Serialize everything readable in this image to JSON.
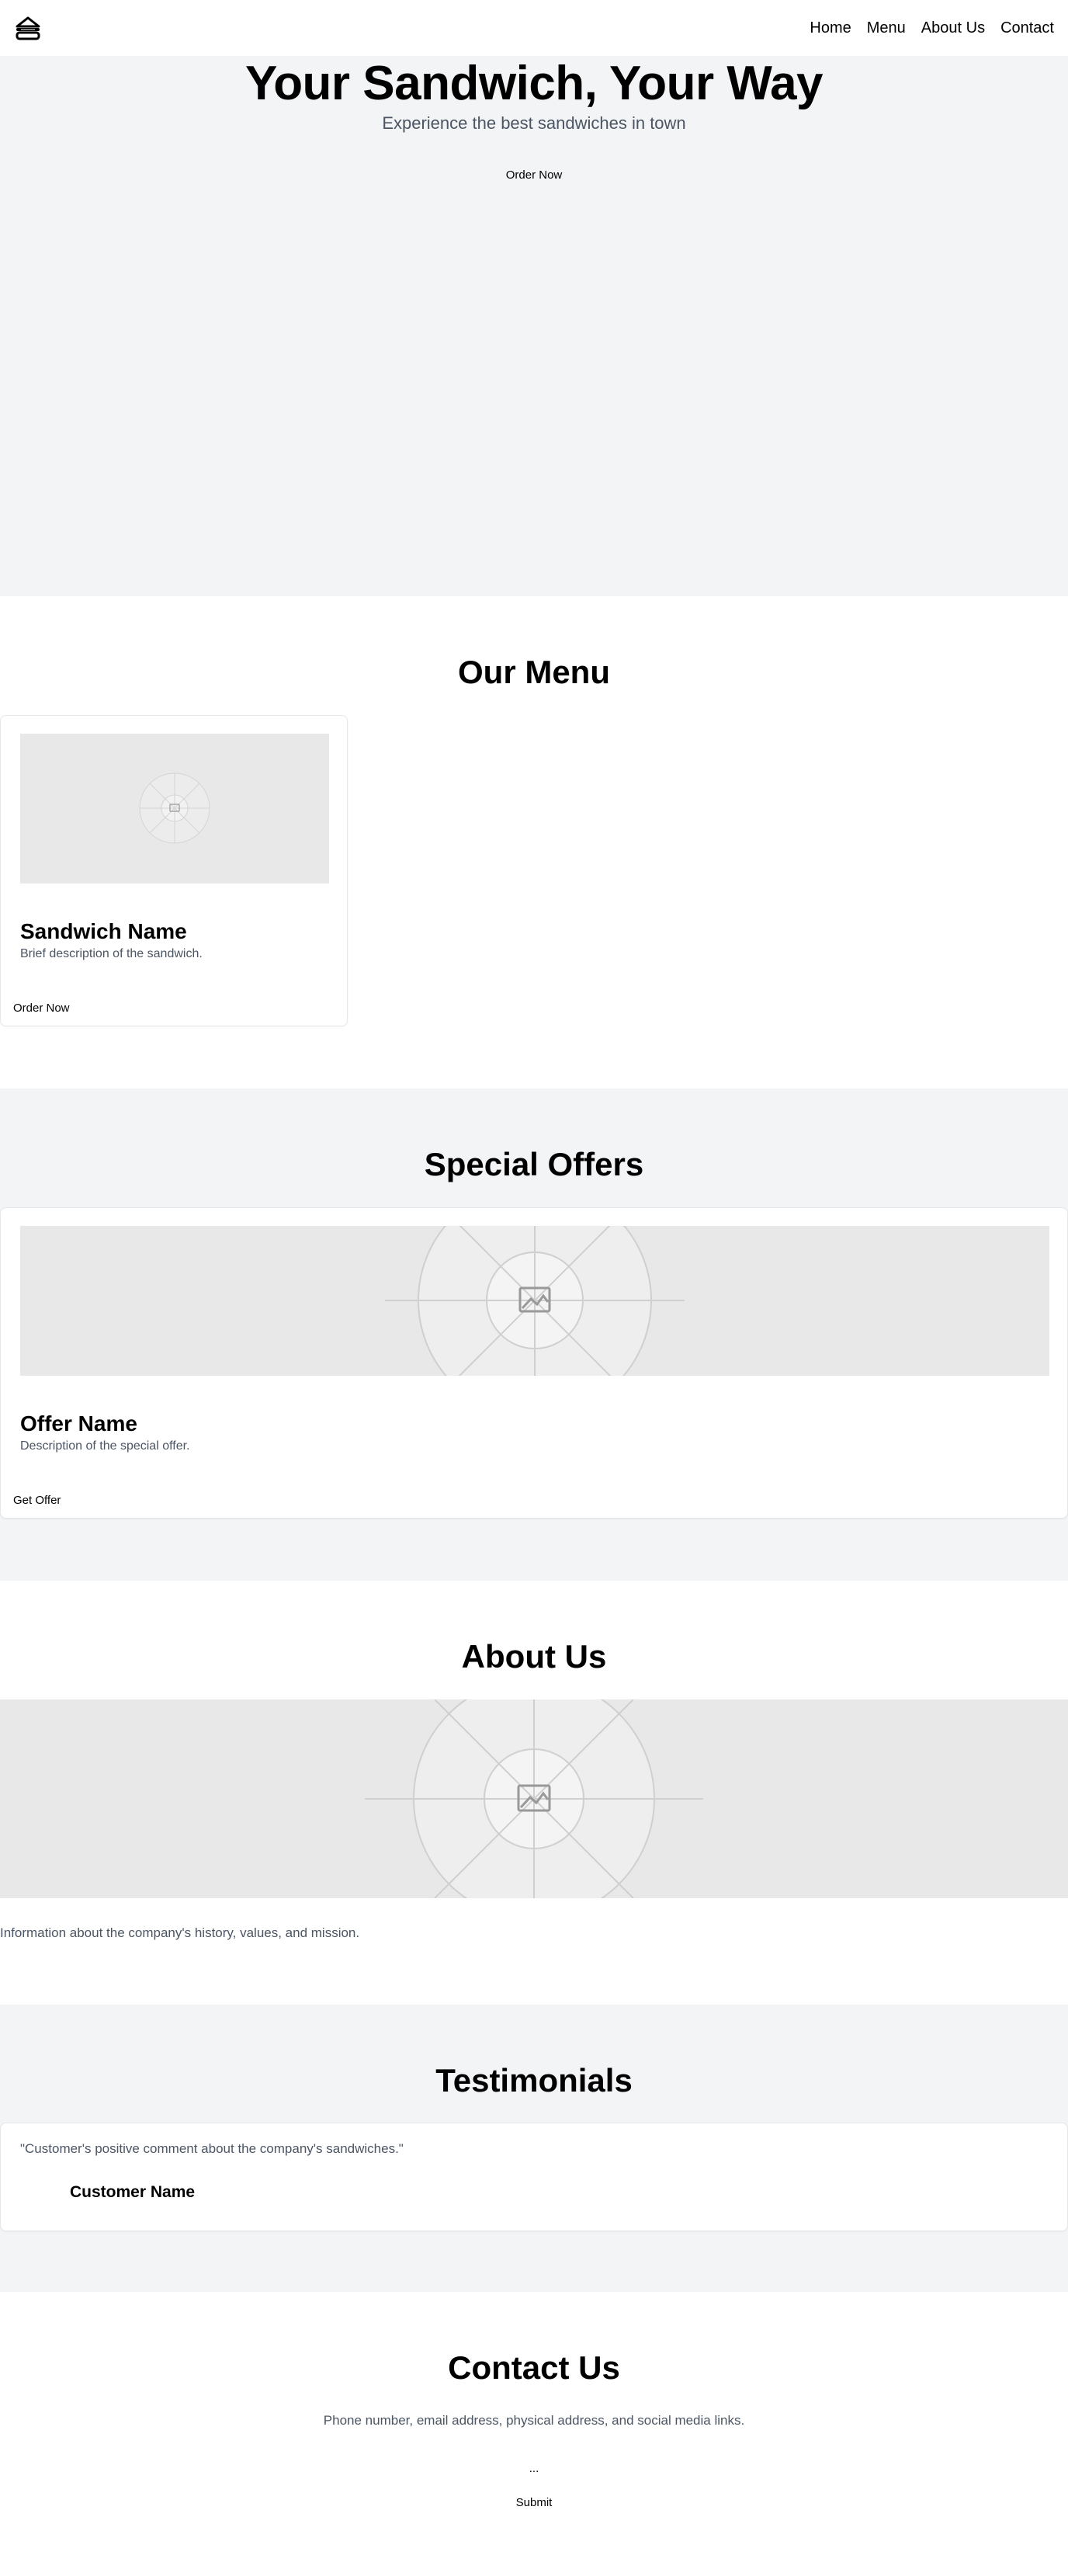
{
  "nav": {
    "logo_icon": "sandwich-icon",
    "links": [
      "Home",
      "Menu",
      "About Us",
      "Contact"
    ]
  },
  "hero": {
    "title": "Your Sandwich, Your Way",
    "subtitle": "Experience the best sandwiches in town",
    "cta": "Order Now"
  },
  "menu": {
    "heading": "Our Menu",
    "item": {
      "image_icon": "image-placeholder-icon",
      "name": "Sandwich Name",
      "description": "Brief description of the sandwich.",
      "cta": "Order Now"
    }
  },
  "offers": {
    "heading": "Special Offers",
    "item": {
      "image_icon": "image-placeholder-icon",
      "name": "Offer Name",
      "description": "Description of the special offer.",
      "cta": "Get Offer"
    }
  },
  "about": {
    "heading": "About Us",
    "image_icon": "image-placeholder-icon",
    "text": "Information about the company's history, values, and mission."
  },
  "testimonials": {
    "heading": "Testimonials",
    "quote": "\"Customer's positive comment about the company's sandwiches.\"",
    "author": "Customer Name"
  },
  "contact": {
    "heading": "Contact Us",
    "info": "Phone number, email address, physical address, and social media links.",
    "form_marker": "...",
    "submit": "Submit"
  },
  "colors": {
    "section_gray": "#f3f4f6",
    "muted_text": "#4b5563",
    "placeholder": "#e8e8e8"
  }
}
